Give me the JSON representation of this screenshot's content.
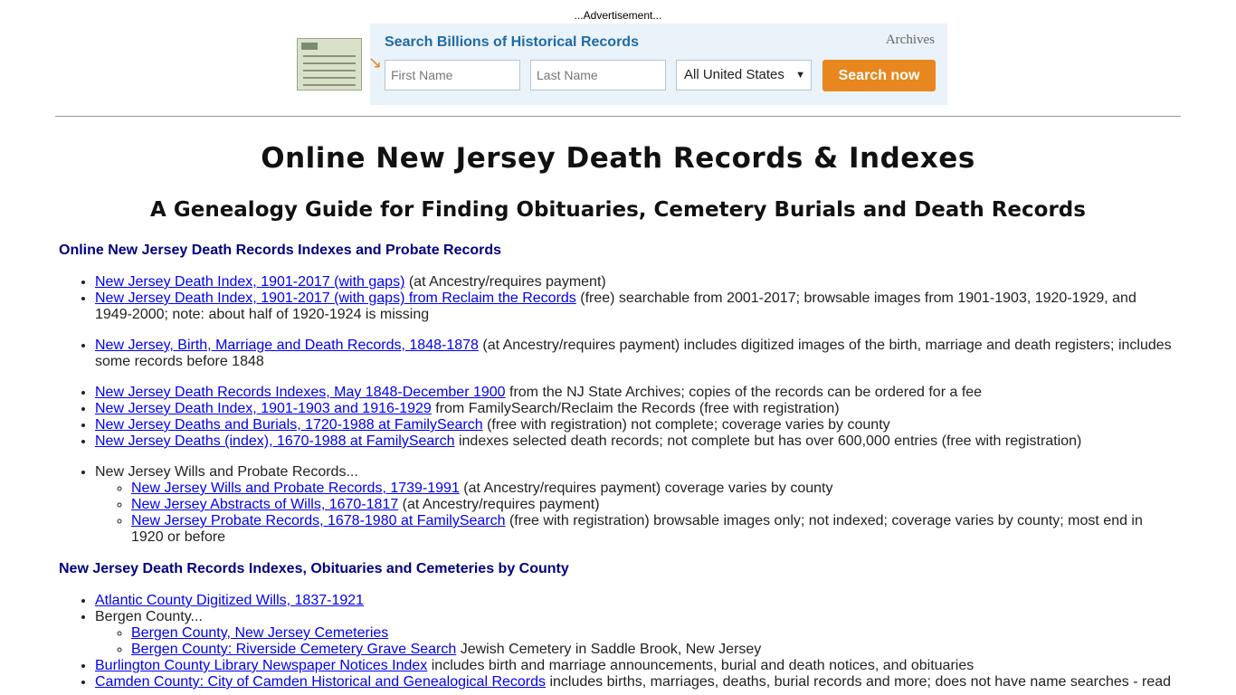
{
  "ad": {
    "label": "...Advertisement...",
    "headline": "Search Billions of Historical Records",
    "brand": "Archives",
    "first_name_placeholder": "First Name",
    "last_name_placeholder": "Last Name",
    "location_selected": "All United States",
    "search_button": "Search now",
    "accent_color": "#e8861f"
  },
  "page": {
    "title": "Online New Jersey Death Records & Indexes",
    "subtitle": "A Genealogy Guide for Finding Obituaries, Cemetery Burials and Death Records"
  },
  "section1": {
    "heading": "Online New Jersey Death Records Indexes and Probate Records",
    "group1": [
      {
        "link": "New Jersey Death Index, 1901-2017 (with gaps)",
        "note": " (at Ancestry/requires payment)"
      },
      {
        "link": "New Jersey Death Index, 1901-2017 (with gaps) from Reclaim the Records",
        "note": " (free) searchable from 2001-2017; browsable images from 1901-1903, 1920-1929, and 1949-2000; note: about half of 1920-1924 is missing"
      }
    ],
    "group2": [
      {
        "link": "New Jersey, Birth, Marriage and Death Records, 1848-1878",
        "note": " (at Ancestry/requires payment) includes digitized images of the birth, marriage and death registers; includes some records before 1848"
      }
    ],
    "group3": [
      {
        "link": "New Jersey Death Records Indexes, May 1848-December 1900",
        "note": " from the NJ State Archives; copies of the records can be ordered for a fee"
      },
      {
        "link": "New Jersey Death Index, 1901-1903 and 1916-1929",
        "note": " from FamilySearch/Reclaim the Records (free with registration)"
      },
      {
        "link": "New Jersey Deaths and Burials, 1720-1988 at FamilySearch",
        "note": " (free with registration) not complete; coverage varies by county"
      },
      {
        "link": "New Jersey Deaths (index), 1670-1988 at FamilySearch",
        "note": " indexes selected death records; not complete but has over 600,000 entries (free with registration)"
      }
    ],
    "wills_label": "New Jersey Wills and Probate Records...",
    "wills": [
      {
        "link": "New Jersey Wills and Probate Records, 1739-1991",
        "note": " (at Ancestry/requires payment) coverage varies by county"
      },
      {
        "link": "New Jersey Abstracts of Wills, 1670-1817",
        "note": " (at Ancestry/requires payment)"
      },
      {
        "link": "New Jersey Probate Records, 1678-1980 at FamilySearch",
        "note": " (free with registration) browsable images only; not indexed; coverage varies by county; most end in 1920 or before"
      }
    ]
  },
  "section2": {
    "heading": "New Jersey Death Records Indexes, Obituaries and Cemeteries by County",
    "atlantic": {
      "link": "Atlantic County Digitized Wills, 1837-1921"
    },
    "bergen_label": "Bergen County...",
    "bergen": [
      {
        "link": "Bergen County, New Jersey Cemeteries",
        "note": ""
      },
      {
        "link": "Bergen County: Riverside Cemetery Grave Search",
        "note": " Jewish Cemetery in Saddle Brook, New Jersey"
      }
    ],
    "burlington": {
      "link": "Burlington County Library Newspaper Notices Index",
      "note": " includes birth and marriage announcements, burial and death notices, and obituaries"
    },
    "camden": {
      "link": "Camden County: City of Camden Historical and Genealogical Records",
      "note": " includes births, marriages, deaths, burial records and more; does not have name searches - read"
    }
  }
}
